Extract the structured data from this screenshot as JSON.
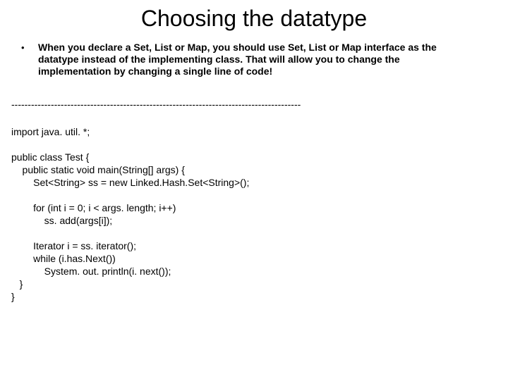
{
  "title": "Choosing the datatype",
  "bullet": {
    "marker": "•",
    "text": "When you declare a Set, List or Map, you should use Set, List or Map interface as the datatype instead of the implementing class.  That will allow you to change the implementation by changing a single line of code!"
  },
  "separator": "----------------------------------------------------------------------------------------",
  "code": "import java. util. *;\n\npublic class Test {\n    public static void main(String[] args) {\n        Set<String> ss = new Linked.Hash.Set<String>();\n\n        for (int i = 0; i < args. length; i++)\n            ss. add(args[i]);\n\n        Iterator i = ss. iterator();\n        while (i.has.Next())\n            System. out. println(i. next());\n   }\n}"
}
